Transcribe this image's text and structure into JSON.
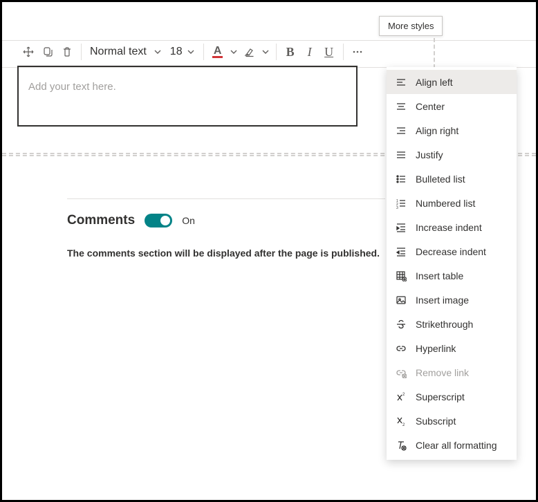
{
  "tooltip": "More styles",
  "toolbar": {
    "textStyle": "Normal text",
    "fontSize": "18",
    "colorLetter": "A"
  },
  "editor": {
    "placeholder": "Add your text here."
  },
  "comments": {
    "title": "Comments",
    "state": "On",
    "description": "The comments section will be displayed after the page is published."
  },
  "menu": {
    "items": [
      {
        "label": "Align left"
      },
      {
        "label": "Center"
      },
      {
        "label": "Align right"
      },
      {
        "label": "Justify"
      },
      {
        "label": "Bulleted list"
      },
      {
        "label": "Numbered list"
      },
      {
        "label": "Increase indent"
      },
      {
        "label": "Decrease indent"
      },
      {
        "label": "Insert table"
      },
      {
        "label": "Insert image"
      },
      {
        "label": "Strikethrough"
      },
      {
        "label": "Hyperlink"
      },
      {
        "label": "Remove link"
      },
      {
        "label": "Superscript"
      },
      {
        "label": "Subscript"
      },
      {
        "label": "Clear all formatting"
      }
    ]
  }
}
